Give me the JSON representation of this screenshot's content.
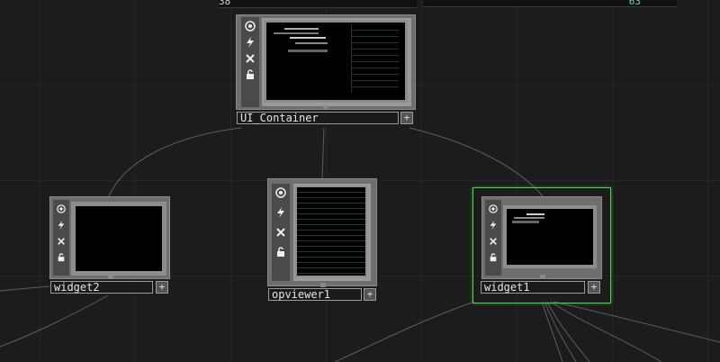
{
  "topbar": {
    "field_left": "38",
    "field_right": "63"
  },
  "nodes": {
    "ui_container": {
      "label": "UI_Container",
      "plus": "+"
    },
    "widget2": {
      "label": "widget2",
      "plus": "+"
    },
    "opviewer1": {
      "label": "opviewer1",
      "plus": "+"
    },
    "widget1": {
      "label": "widget1",
      "plus": "+",
      "selected": true
    }
  },
  "icons": [
    "target-icon",
    "bolt-icon",
    "close-icon",
    "lock-icon"
  ],
  "colors": {
    "background": "#1c1c1c",
    "node_body": "#6e6e6e",
    "selection": "#4bd34b",
    "wire": "#6a6a6a"
  }
}
